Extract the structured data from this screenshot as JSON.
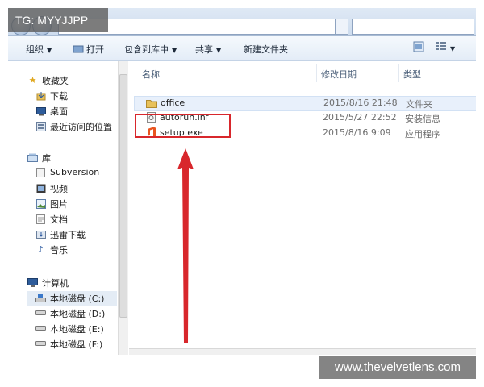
{
  "watermark": {
    "tg": "TG: MYYJJPP",
    "site": "www.thevelvetlens.com"
  },
  "toolbar": {
    "organize": "组织",
    "open": "打开",
    "include_library": "包含到库中",
    "share": "共享",
    "new_folder": "新建文件夹"
  },
  "sidebar": {
    "favorites": {
      "label": "收藏夹",
      "items": [
        "下载",
        "桌面",
        "最近访问的位置"
      ]
    },
    "libraries": {
      "label": "库",
      "items": [
        "Subversion",
        "视频",
        "图片",
        "文档",
        "迅雷下载",
        "音乐"
      ]
    },
    "computer": {
      "label": "计算机",
      "items": [
        "本地磁盘 (C:)",
        "本地磁盘 (D:)",
        "本地磁盘 (E:)",
        "本地磁盘 (F:)"
      ]
    }
  },
  "columns": {
    "name": "名称",
    "modified": "修改日期",
    "type": "类型"
  },
  "files": [
    {
      "name": "office",
      "modified": "2015/8/16 21:48",
      "type": "文件夹",
      "icon": "folder-icon"
    },
    {
      "name": "autorun.inf",
      "modified": "2015/5/27 22:52",
      "type": "安装信息",
      "icon": "settings-file-icon"
    },
    {
      "name": "setup.exe",
      "modified": "2015/8/16 9:09",
      "type": "应用程序",
      "icon": "office-app-icon"
    }
  ],
  "colors": {
    "annotation": "#d8272c",
    "folder": "#e8c15a",
    "office": "#e9541f"
  }
}
